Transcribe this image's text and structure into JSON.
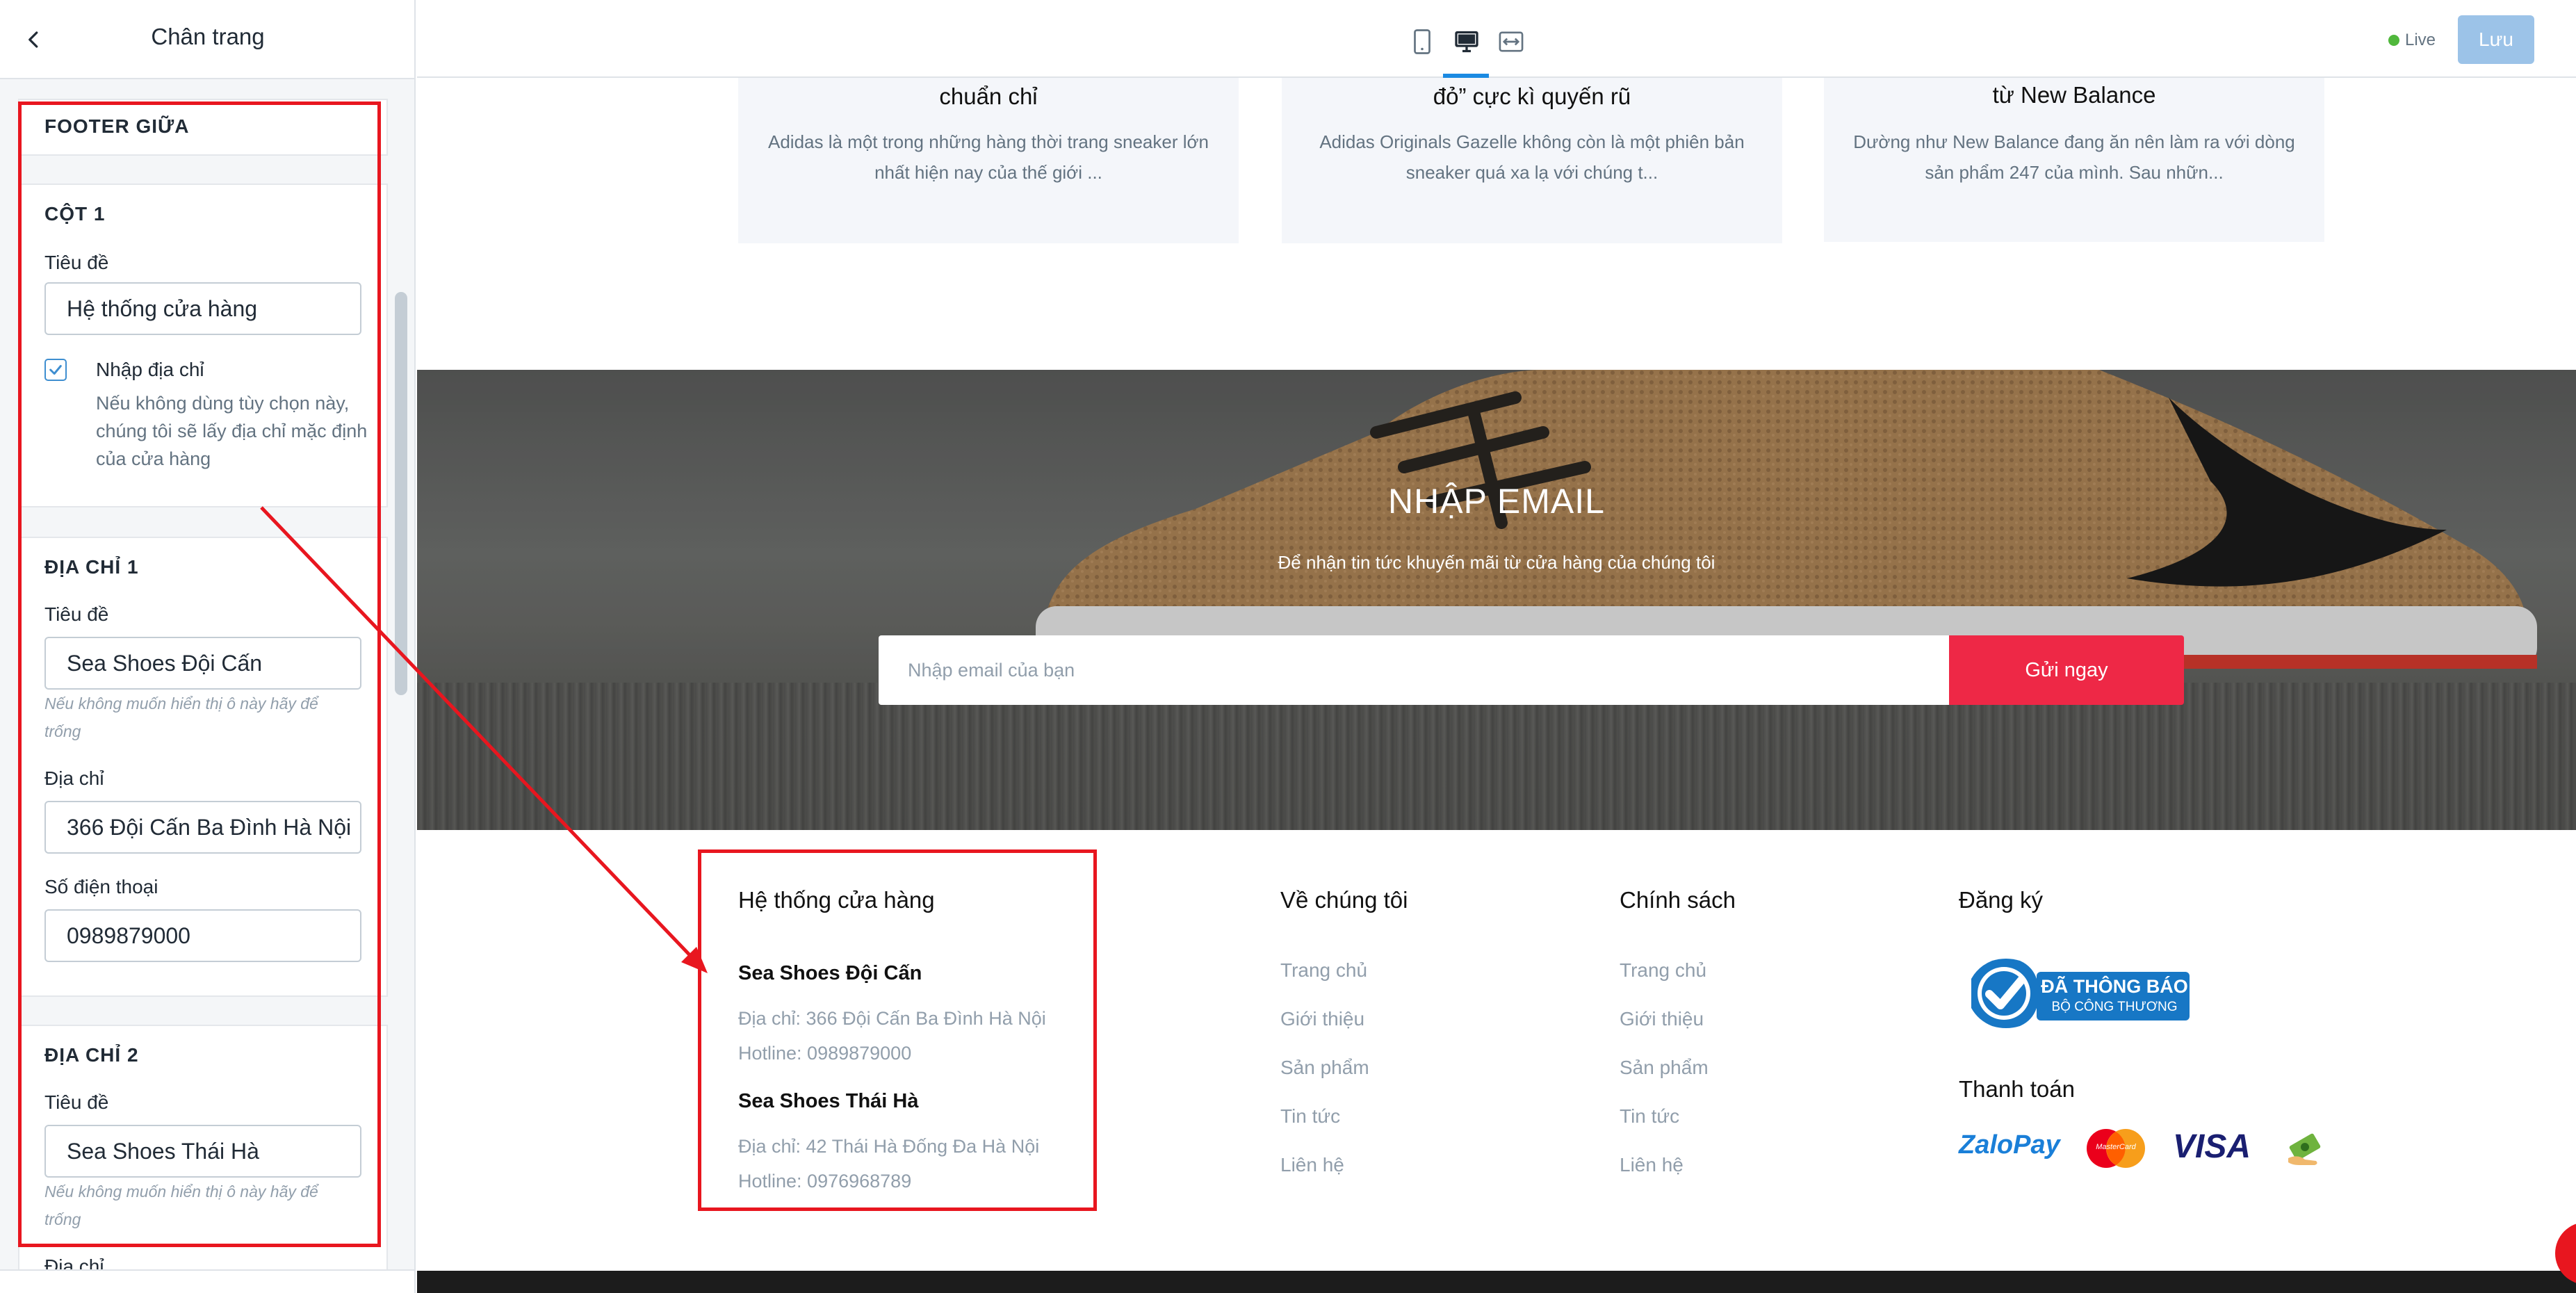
{
  "sidebar": {
    "title": "Chân trang",
    "section_title": "FOOTER GIỮA",
    "col1": {
      "title": "CỘT 1",
      "label_title": "Tiêu đề",
      "value_title": "Hệ thống cửa hàng",
      "checkbox_label": "Nhập địa chỉ",
      "checkbox_checked": true,
      "checkbox_desc": "Nếu không dùng tùy chọn này, chúng tôi sẽ lấy địa chỉ mặc định của cửa hàng"
    },
    "addr1": {
      "title": "ĐỊA CHỈ 1",
      "label_title": "Tiêu đề",
      "value_title": "Sea Shoes Đội Cấn",
      "hint": "Nếu không muốn hiển thị ô này hãy để trống",
      "label_address": "Địa chỉ",
      "value_address": "366 Đội Cấn Ba Đình Hà Nội",
      "label_phone": "Số điện thoại",
      "value_phone": "0989879000"
    },
    "addr2": {
      "title": "ĐỊA CHỈ 2",
      "label_title": "Tiêu đề",
      "value_title": "Sea Shoes Thái Hà",
      "hint": "Nếu không muốn hiển thị ô này hãy để trống",
      "label_address": "Địa chỉ"
    }
  },
  "topbar": {
    "live_label": "Live",
    "save_label": "Lưu",
    "device_icons": [
      "mobile-icon",
      "desktop-icon",
      "fullwidth-icon"
    ]
  },
  "blog": [
    {
      "title": "chuẩn chỉ",
      "desc": "Adidas là một trong những hàng thời trang sneaker lớn nhất hiện nay của thế giới ..."
    },
    {
      "title": "đỏ” cực kì quyến rũ",
      "desc": "Adidas Originals Gazelle không còn là một phiên bản sneaker quá xa lạ với chúng t..."
    },
    {
      "title": "từ New Balance",
      "desc": "Dường như New Balance đang ăn nên làm ra với dòng sản phẩm 247 của mình. Sau nhữn..."
    }
  ],
  "newsletter": {
    "title": "NHẬP EMAIL",
    "subtitle": "Để nhận tin tức khuyến mãi từ cửa hàng của chúng tôi",
    "placeholder": "Nhập email của bạn",
    "button": "Gửi ngay"
  },
  "footer": {
    "col1": {
      "title": "Hệ thống cửa hàng",
      "stores": [
        {
          "name": "Sea Shoes Đội Cấn",
          "address": "Địa chỉ: 366 Đội Cấn Ba Đình Hà Nội",
          "hotline": "Hotline: 0989879000"
        },
        {
          "name": "Sea Shoes Thái Hà",
          "address": "Địa chỉ: 42 Thái Hà Đống Đa Hà Nội",
          "hotline": "Hotline: 0976968789"
        }
      ]
    },
    "col2": {
      "title": "Về chúng tôi",
      "links": [
        "Trang chủ",
        "Giới thiệu",
        "Sản phẩm",
        "Tin tức",
        "Liên hệ"
      ]
    },
    "col3": {
      "title": "Chính sách",
      "links": [
        "Trang chủ",
        "Giới thiệu",
        "Sản phẩm",
        "Tin tức",
        "Liên hệ"
      ]
    },
    "col4": {
      "title": "Đăng ký",
      "badge_line1": "ĐÃ THÔNG BÁO",
      "badge_line2": "BỘ CÔNG THƯƠNG",
      "payment_title": "Thanh toán",
      "payments": [
        "ZaloPay",
        "MasterCard",
        "VISA"
      ]
    }
  },
  "colors": {
    "accent": "#1b8ae2",
    "annotation_red": "#e8161f",
    "cta_red": "#ee2846",
    "save_button": "#9cc3e8"
  }
}
